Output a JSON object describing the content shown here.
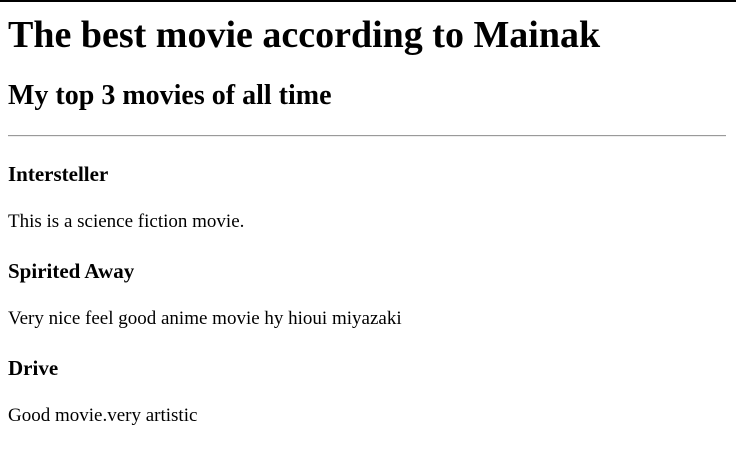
{
  "page": {
    "heading": "The best movie according to Mainak",
    "subheading": "My top 3 movies of all time"
  },
  "movies": [
    {
      "title": "Intersteller",
      "description": "This is a science fiction movie."
    },
    {
      "title": "Spirited Away",
      "description": "Very nice feel good anime movie hy hioui miyazaki"
    },
    {
      "title": "Drive",
      "description": "Good movie.very artistic"
    }
  ]
}
